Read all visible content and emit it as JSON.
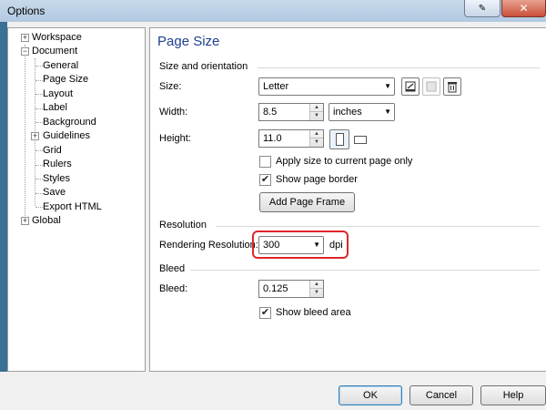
{
  "window": {
    "title": "Options"
  },
  "tree": {
    "items": [
      {
        "label": "Workspace",
        "expander": "+"
      },
      {
        "label": "Document",
        "expander": "−"
      },
      {
        "label": "General"
      },
      {
        "label": "Page Size"
      },
      {
        "label": "Layout"
      },
      {
        "label": "Label"
      },
      {
        "label": "Background"
      },
      {
        "label": "Guidelines",
        "expander": "+"
      },
      {
        "label": "Grid"
      },
      {
        "label": "Rulers"
      },
      {
        "label": "Styles"
      },
      {
        "label": "Save"
      },
      {
        "label": "Export HTML"
      },
      {
        "label": "Global",
        "expander": "+"
      }
    ]
  },
  "panel": {
    "title": "Page Size",
    "size_orientation": {
      "heading": "Size and orientation",
      "size_label": "Size:",
      "size_value": "Letter",
      "width_label": "Width:",
      "width_value": "8.5",
      "units_value": "inches",
      "height_label": "Height:",
      "height_value": "11.0",
      "apply_current_label": "Apply size to current page only",
      "apply_current_checked": false,
      "show_border_label": "Show page border",
      "show_border_checked": true,
      "add_frame_label": "Add Page Frame"
    },
    "resolution": {
      "heading": "Resolution",
      "rendering_label": "Rendering Resolution:",
      "rendering_value": "300",
      "unit": "dpi"
    },
    "bleed": {
      "heading": "Bleed",
      "bleed_label": "Bleed:",
      "bleed_value": "0.125",
      "show_bleed_label": "Show bleed area",
      "show_bleed_checked": true
    }
  },
  "footer": {
    "ok_label": "OK",
    "cancel_label": "Cancel",
    "help_label": "Help"
  },
  "icons": {
    "close": "close-icon",
    "help": "help-icon",
    "save_preset": "save-preset-icon",
    "page": "page-icon",
    "delete": "trash-icon",
    "portrait": "portrait-icon",
    "landscape": "landscape-icon"
  },
  "colors": {
    "title_blue": "#1e3f8f",
    "highlight_red": "#e0262b",
    "panel_bg": "#ffffff"
  }
}
